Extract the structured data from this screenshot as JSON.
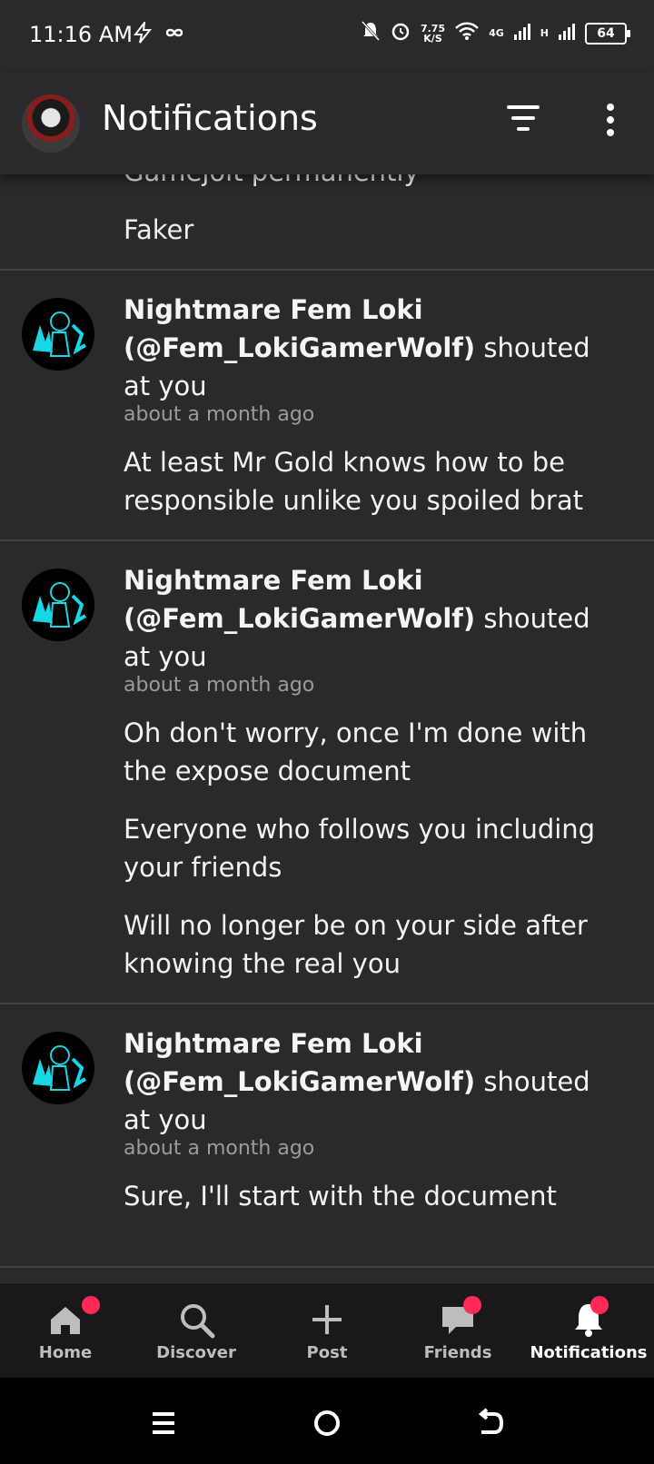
{
  "status_bar": {
    "time": "11:16 AM",
    "left_icons": [
      "flash-icon",
      "infinity-icon"
    ],
    "net_speed_value": "7.75",
    "net_speed_unit": "K/S",
    "network_label_1": "4G",
    "network_label_2": "H",
    "battery": "64"
  },
  "app_bar": {
    "title": "Notifications"
  },
  "partial_item": {
    "line_1": "Gamejolt permanently",
    "line_2": "Faker"
  },
  "notifications": [
    {
      "name": "Nightmare Fem Loki",
      "handle": "(@Fem_LokiGamerWolf)",
      "action_1": "shouted",
      "action_2": "at you",
      "time": "about a month ago",
      "messages": [
        "At least Mr Gold knows how to be responsible unlike you spoiled brat"
      ]
    },
    {
      "name": "Nightmare Fem Loki",
      "handle": "(@Fem_LokiGamerWolf)",
      "action_1": "shouted",
      "action_2": "at you",
      "time": "about a month ago",
      "messages": [
        "Oh don't worry, once I'm done with the expose document",
        "Everyone who follows you including your friends",
        "Will no longer be on your side after knowing the real you"
      ]
    },
    {
      "name": "Nightmare Fem Loki",
      "handle": "(@Fem_LokiGamerWolf)",
      "action_1": "shouted",
      "action_2": "at you",
      "time": "about a month ago",
      "messages": [
        "Sure, I'll start with the document"
      ]
    }
  ],
  "bottom_nav": {
    "items": [
      {
        "label": "Home",
        "icon": "home-icon",
        "badge": true
      },
      {
        "label": "Discover",
        "icon": "search-icon",
        "badge": false
      },
      {
        "label": "Post",
        "icon": "plus-icon",
        "badge": false
      },
      {
        "label": "Friends",
        "icon": "chat-icon",
        "badge": true
      },
      {
        "label": "Notifications",
        "icon": "bell-icon",
        "badge": true
      }
    ],
    "badge_color": "#ff2a55"
  },
  "system_nav": [
    "recents-icon",
    "home-circle-icon",
    "back-icon"
  ]
}
